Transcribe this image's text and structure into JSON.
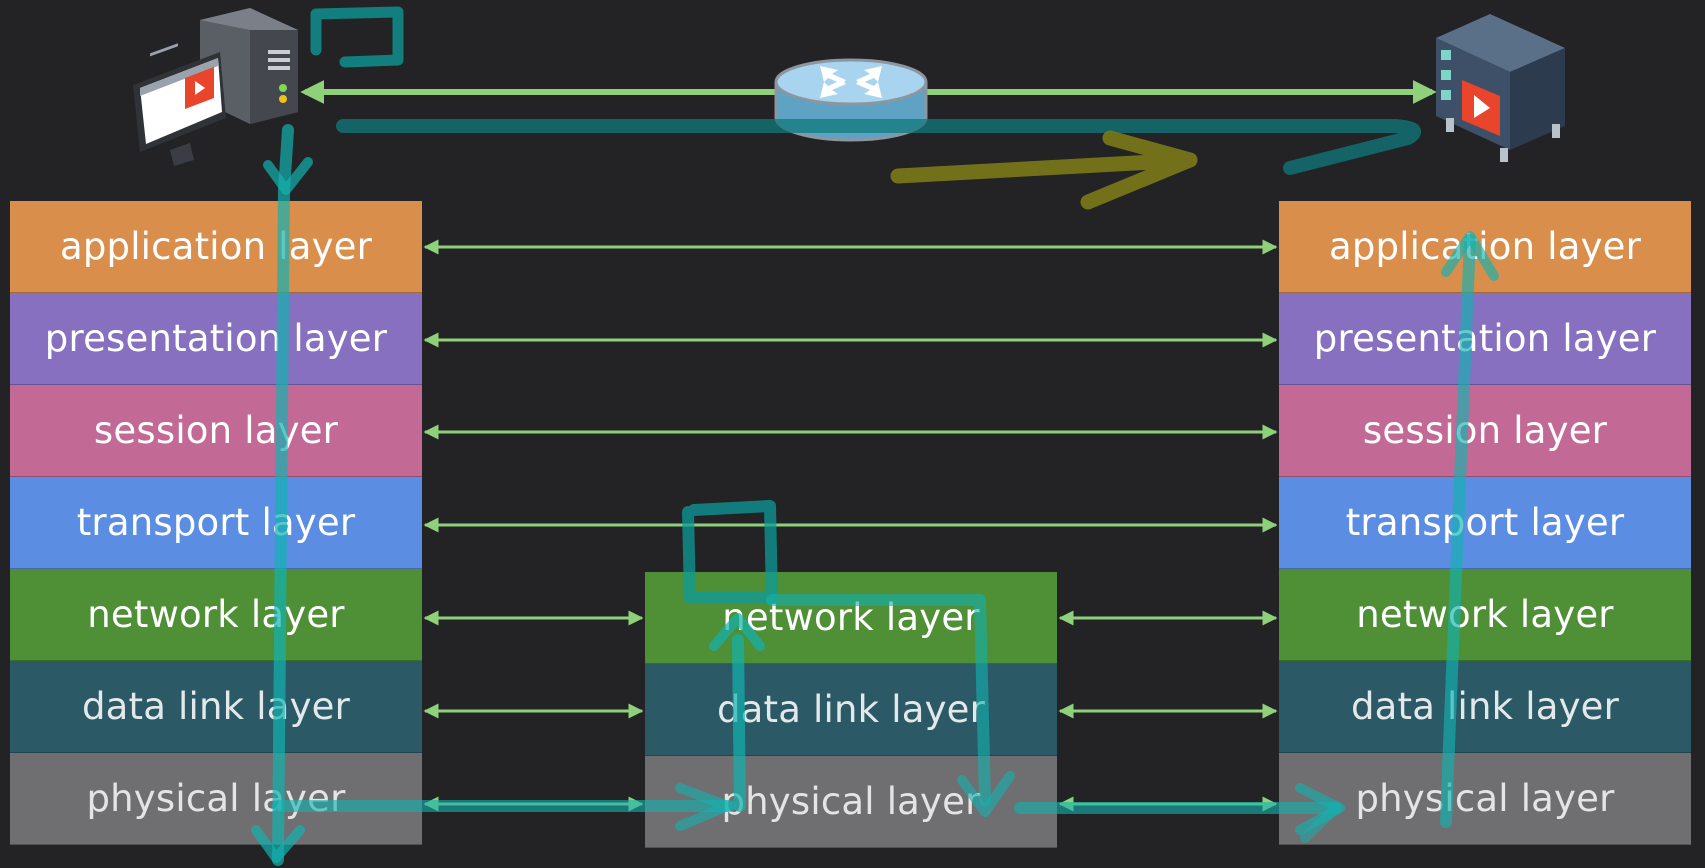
{
  "diagram": {
    "left_stack": [
      {
        "label": "application layer"
      },
      {
        "label": "presentation layer"
      },
      {
        "label": "session layer"
      },
      {
        "label": "transport layer"
      },
      {
        "label": "network layer"
      },
      {
        "label": "data link layer"
      },
      {
        "label": "physical layer"
      }
    ],
    "middle_stack": [
      {
        "label": "network layer"
      },
      {
        "label": "data link layer"
      },
      {
        "label": "physical layer"
      }
    ],
    "right_stack": [
      {
        "label": "application layer"
      },
      {
        "label": "presentation layer"
      },
      {
        "label": "session layer"
      },
      {
        "label": "transport layer"
      },
      {
        "label": "network layer"
      },
      {
        "label": "data link layer"
      },
      {
        "label": "physical layer"
      }
    ],
    "devices": {
      "left": "desktop-computer-icon",
      "middle": "router-icon",
      "right": "server-icon"
    },
    "colors": {
      "application": "#d98e4c",
      "presentation": "#8770bf",
      "session": "#c26a95",
      "transport": "#5b8ee3",
      "network": "#4f8f36",
      "data_link": "#2b5a66",
      "physical": "#6f6e70",
      "arrow": "#8fd17a",
      "annotation_teal": "#14a8a6",
      "annotation_olive": "#7a7a1a",
      "background": "#232224"
    }
  }
}
